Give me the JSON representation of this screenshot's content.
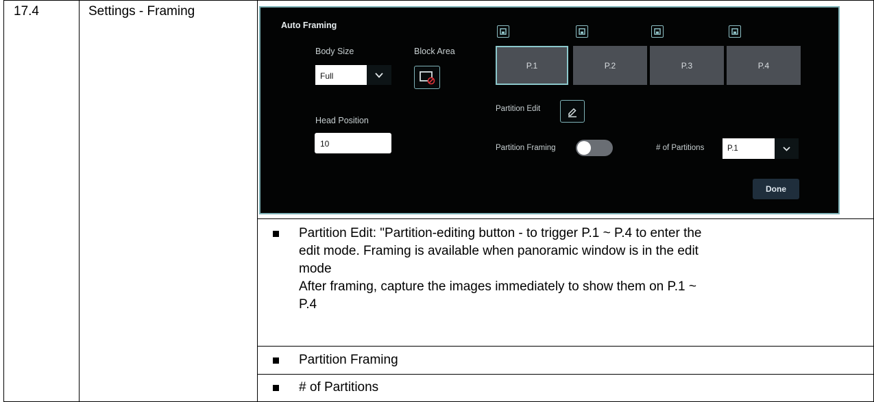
{
  "row": {
    "number": "17.4",
    "name": "Settings - Framing"
  },
  "panel": {
    "title": "Auto Framing",
    "body_size": {
      "label": "Body Size",
      "value": "Full"
    },
    "block_area": {
      "label": "Block Area"
    },
    "head_position": {
      "label": "Head Position",
      "value": "10"
    },
    "partitions": [
      "P.1",
      "P.2",
      "P.3",
      "P.4"
    ],
    "selected_partition": "P.1",
    "partition_edit": {
      "label": "Partition Edit"
    },
    "partition_framing": {
      "label": "Partition Framing",
      "enabled": false
    },
    "num_partitions": {
      "label": "# of Partitions",
      "value": "P.1"
    },
    "done_label": "Done",
    "colors": {
      "background": "#030404",
      "accent": "#7fb3b8",
      "tile": "#4b4f55",
      "done": "#1f2e3c"
    }
  },
  "notes": {
    "bullet1_lines": [
      "Partition Edit: \"Partition-editing button - to trigger P.1 ~ P.4 to enter the",
      "edit mode. Framing is available when panoramic window is in the edit",
      "mode",
      "After framing, capture the images immediately to show them on P.1 ~",
      "P.4"
    ],
    "bullet2": "Partition Framing",
    "bullet3": "# of Partitions"
  }
}
